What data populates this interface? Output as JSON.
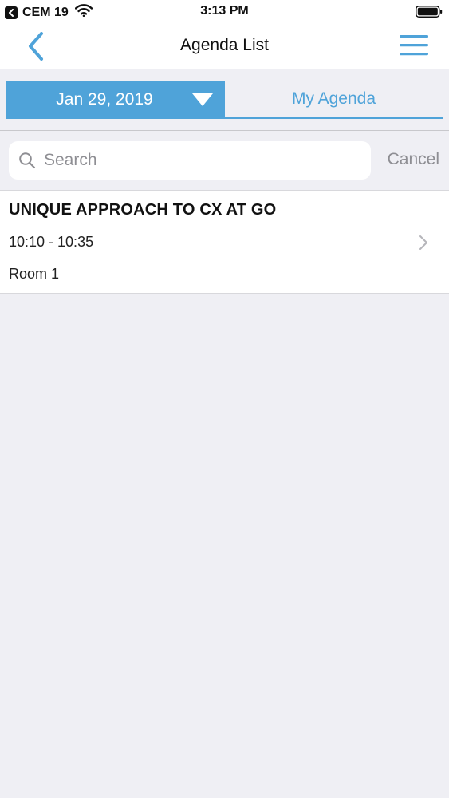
{
  "status_bar": {
    "back_app_label": "CEM 19",
    "time": "3:13 PM"
  },
  "nav": {
    "title": "Agenda List"
  },
  "tabs": {
    "date_label": "Jan 29, 2019",
    "my_agenda_label": "My Agenda"
  },
  "search": {
    "placeholder": "Search",
    "value": "",
    "cancel_label": "Cancel"
  },
  "agenda": {
    "items": [
      {
        "title": "UNIQUE APPROACH TO CX AT GO",
        "time": "10:10 - 10:35",
        "room": "Room 1"
      }
    ]
  },
  "colors": {
    "accent": "#4fa3d9",
    "background": "#efeff4",
    "secondary_text": "#8e8e93"
  },
  "icons": {
    "back": "chevron-left-icon",
    "menu": "hamburger-menu-icon",
    "dropdown": "caret-down-icon",
    "search": "search-icon",
    "row_disclosure": "chevron-right-icon",
    "wifi": "wifi-icon",
    "battery": "battery-icon"
  }
}
